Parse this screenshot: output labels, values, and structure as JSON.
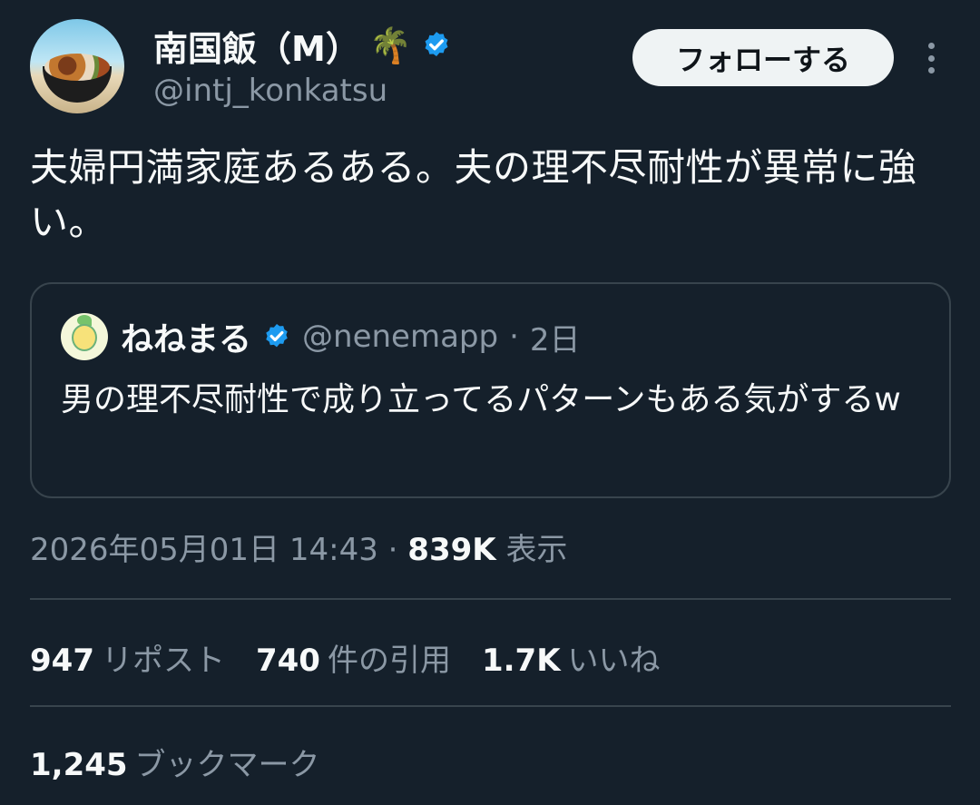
{
  "author": {
    "display_name": "南国飯（M）",
    "emoji": "🌴",
    "handle": "@intj_konkatsu",
    "verified": true
  },
  "follow_button": {
    "label": "フォローする"
  },
  "tweet": {
    "text": "夫婦円満家庭あるある。夫の理不尽耐性が異常に強い。"
  },
  "quoted_tweet": {
    "display_name": "ねねまる",
    "handle": "@nenemapp",
    "separator": "·",
    "time": "2日",
    "text": "男の理不尽耐性で成り立ってるパターンもある気がするw"
  },
  "meta": {
    "date": "2026年05月01日 14:43",
    "separator": "·",
    "views_count": "839K",
    "views_label": "表示"
  },
  "stats": {
    "reposts_count": "947",
    "reposts_label": "リポスト",
    "quotes_count": "740",
    "quotes_label": "件の引用",
    "likes_count": "1.7K",
    "likes_label": "いいね",
    "bookmarks_count": "1,245",
    "bookmarks_label": "ブックマーク"
  },
  "colors": {
    "background": "#15202b",
    "text_primary": "#f7f9f9",
    "text_secondary": "#8b98a5",
    "verified_blue": "#1d9bf0",
    "border": "#38444d",
    "button_bg": "#eff3f4"
  },
  "icons": {
    "verified": "verified-badge-icon",
    "more": "more-vertical-icon"
  }
}
